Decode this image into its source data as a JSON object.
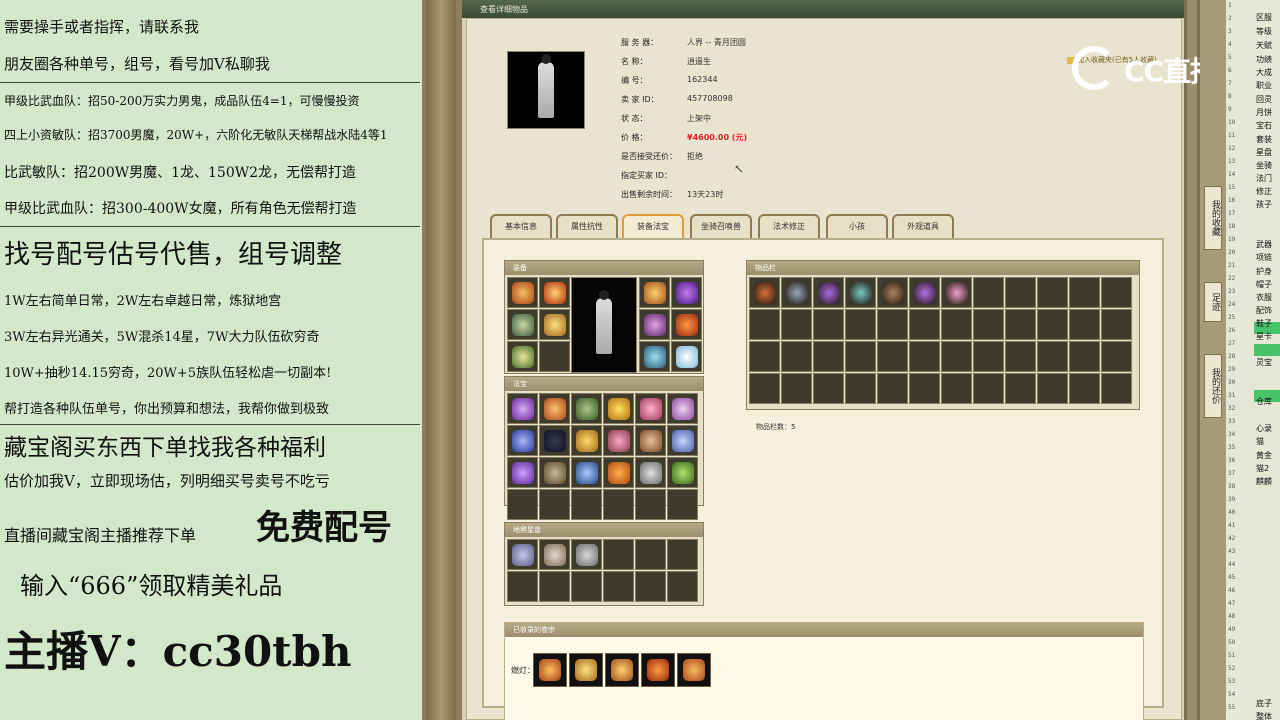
{
  "overlay": {
    "lines": [
      "需要操手或者指挥，请联系我",
      "朋友圈各种单号，组号，看号加V私聊我",
      "甲级比武血队：招50-200万实力男鬼，成品队伍4=1，可慢慢投资",
      "四上小资敏队：招3700男魔，20W+，六阶化无敏队天梯帮战水陆4等1",
      "比武敏队：招200W男魔、1龙、150W2龙，无偿帮打造",
      "甲级比武血队：招300-400W女魔，所有角色无偿帮打造",
      "找号配号估号代售，组号调整",
      "1W左右简单日常，2W左右卓越日常，炼狱地宫",
      "3W左右异光通关，5W混杀14星，7W大力队伍砍穷奇",
      "10W+抽秒14.15穷奇，20W+5族队伍轻松虐一切副本!",
      "帮打造各种队伍单号，你出预算和想法，我帮你做到极致",
      "藏宝阁买东西下单找我各种福利",
      "估价加我V，立即现场估，列明细买号卖号不吃亏",
      "直播间藏宝阁主播推荐下单",
      "免费配号",
      "输入“666”领取精美礼品",
      "主播V：cc30tbh"
    ]
  },
  "window": {
    "title": "查看详细物品"
  },
  "detail": {
    "rows": [
      {
        "label": "服 务 器：",
        "value": "人界 -- 青月团圆"
      },
      {
        "label": "名       称：",
        "value": "逍遥生"
      },
      {
        "label": "编       号：",
        "value": "162344"
      },
      {
        "label": "卖  家  ID：",
        "value": "457708098"
      },
      {
        "label": "状       态：",
        "value": "上架中"
      },
      {
        "label": "价       格：",
        "value": "¥4600.00 (元)"
      },
      {
        "label": "是否接受还价：",
        "value": "拒绝"
      },
      {
        "label": "指定买家 ID：",
        "value": ""
      },
      {
        "label": "出售剩余时间：",
        "value": "13天23时"
      }
    ],
    "favorite": "加入收藏夹(已有5人收藏)"
  },
  "tabs": [
    "基本信息",
    "属性抗性",
    "装备法宝",
    "坐骑召唤兽",
    "法术修正",
    "小孩",
    "外观道具"
  ],
  "active_tab": "装备法宝",
  "sections": {
    "equip": "装备",
    "fabao": "法宝",
    "dijie": "地煞星兽",
    "items": "物品栏",
    "items_count": "物品栏数：5",
    "collected": "已收录的卷宗",
    "collected_label": "燃灯："
  },
  "logo": {
    "text": "CC直播"
  },
  "right_panel": {
    "buttons": [
      "我的收藏",
      "足迹",
      "我的还价"
    ],
    "labels": [
      "区服",
      "等级",
      "天赋",
      "功绩",
      "大成",
      "职业",
      "回灵",
      "月饼",
      "宝石",
      "套装",
      "星盘",
      "坐骑",
      "法门",
      "修正",
      "孩子",
      "武器",
      "项链",
      "护身",
      "帽子",
      "衣服",
      "配饰",
      "鞋子",
      "星卡",
      "灵宝",
      "仓库",
      "心录",
      "猫",
      "黄金",
      "猫2",
      "麒麟",
      "底子",
      "整体"
    ]
  },
  "colors": {
    "overlay_bg": "#d3e8cb",
    "price": "#dd2222",
    "active_tab_border": "#e19c3a",
    "highlight": "#46c46a"
  }
}
